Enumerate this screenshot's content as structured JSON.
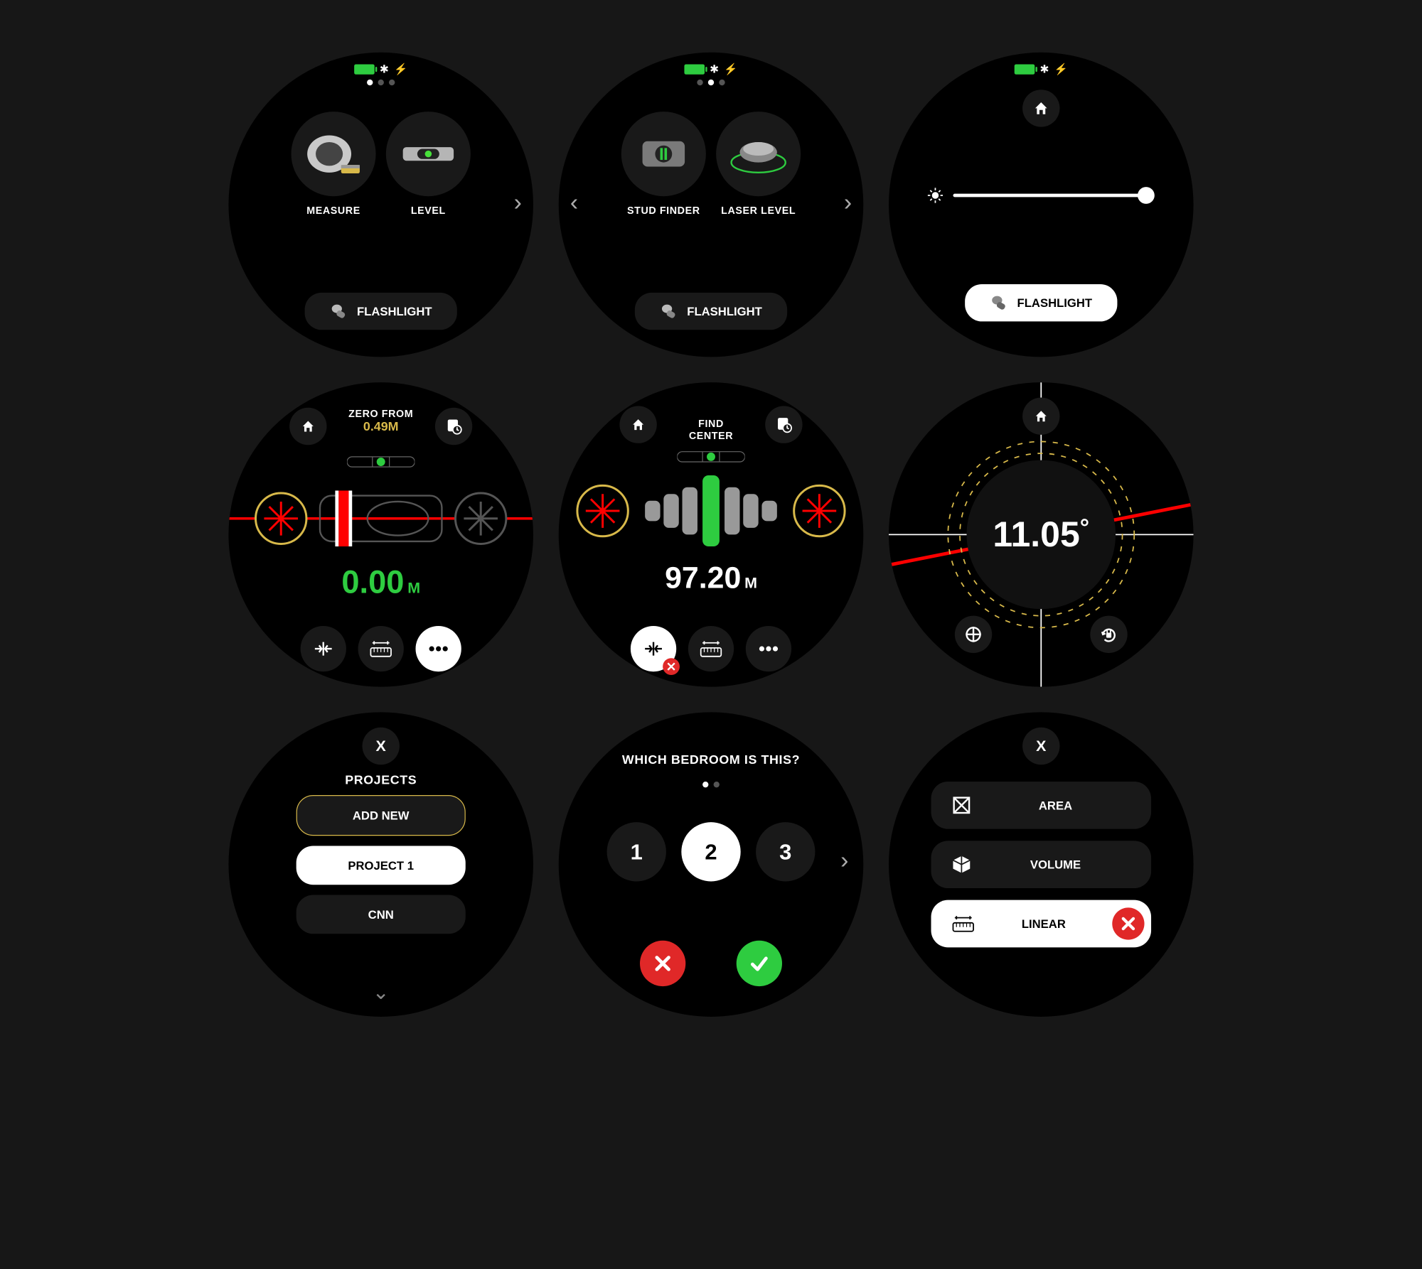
{
  "screen1": {
    "status_icons": "* ⚡",
    "tool_a": "MEASURE",
    "tool_b": "LEVEL",
    "flashlight": "FLASHLIGHT"
  },
  "screen2": {
    "tool_a": "STUD FINDER",
    "tool_b": "LASER LEVEL",
    "flashlight": "FLASHLIGHT"
  },
  "screen3": {
    "flashlight": "FLASHLIGHT"
  },
  "screen4": {
    "zero_label": "ZERO FROM",
    "zero_value": "0.49M",
    "reading": "0.00",
    "unit": "M"
  },
  "screen5": {
    "title": "FIND\nCENTER",
    "reading": "97.20",
    "unit": "M"
  },
  "screen6": {
    "angle": "11.05",
    "deg": "°"
  },
  "screen7": {
    "close": "X",
    "title": "PROJECTS",
    "add": "ADD NEW",
    "proj1": "PROJECT 1",
    "proj2": "CNN"
  },
  "screen8": {
    "question": "WHICH BEDROOM IS THIS?",
    "opt1": "1",
    "opt2": "2",
    "opt3": "3"
  },
  "screen9": {
    "close": "X",
    "area": "AREA",
    "volume": "VOLUME",
    "linear": "LINEAR"
  }
}
